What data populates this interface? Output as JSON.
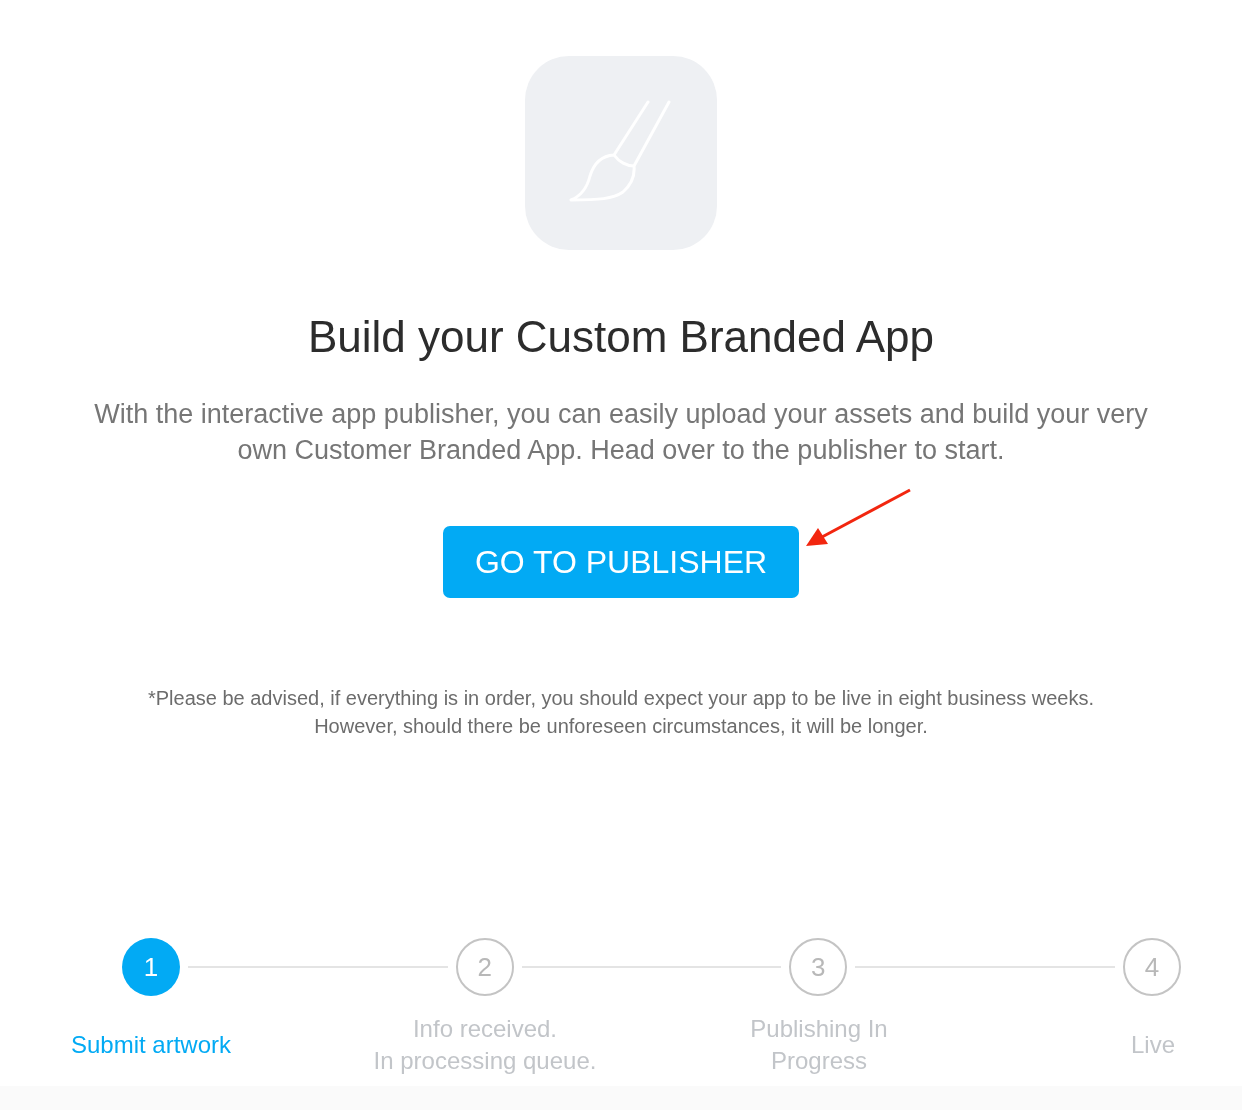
{
  "title": "Build your Custom Branded App",
  "description": "With the interactive app publisher, you can easily upload your assets and build your very own Customer Branded App. Head over to the publisher to start.",
  "button": "GO TO PUBLISHER",
  "note": "*Please be advised, if everything is in order, you should expect your app to be live in eight business weeks. However, should there be unforeseen circumstances, it will be longer.",
  "steps": [
    {
      "number": "1",
      "label": "Submit artwork",
      "active": true
    },
    {
      "number": "2",
      "label": "Info received.\nIn processing queue.",
      "active": false
    },
    {
      "number": "3",
      "label": "Publishing In\nProgress",
      "active": false
    },
    {
      "number": "4",
      "label": "Live",
      "active": false
    }
  ]
}
